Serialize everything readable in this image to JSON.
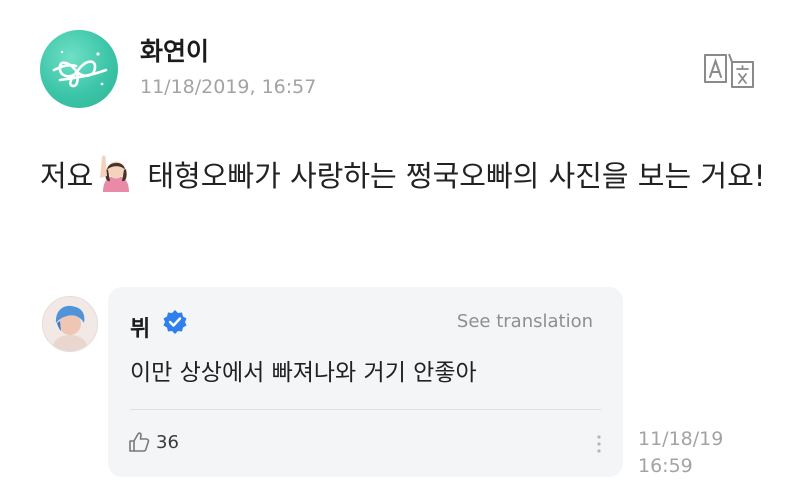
{
  "post": {
    "author": "화연이",
    "timestamp": "11/18/2019, 16:57",
    "body_before_emoji": "저요",
    "emoji": "person-raising-hand-icon",
    "body_after_emoji": "태형오빠가 사랑하는 쩡국오빠의 사진을 보는 거요!",
    "translate_icon": "translate-icon"
  },
  "comment": {
    "author": "뷔",
    "verified_icon": "verified-badge-icon",
    "see_translation": "See translation",
    "text": "이만 상상에서 빠져나와 거기 안좋아",
    "likes": "36",
    "like_icon": "thumbs-up-icon",
    "more_icon": "more-vertical-icon",
    "date": "11/18/19",
    "time": "16:59"
  },
  "colors": {
    "avatar_bg": "#3cc5a8",
    "verified": "#2f80ed",
    "meta_text": "#a3a3a3",
    "card_bg": "#f4f5f7"
  }
}
